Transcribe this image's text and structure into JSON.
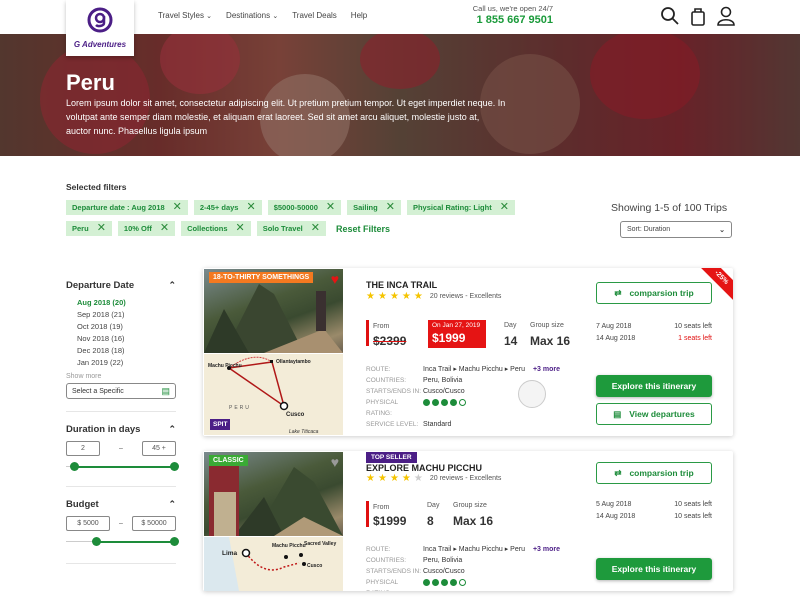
{
  "header": {
    "brand": "G Adventures",
    "nav": [
      {
        "label": "Travel Styles",
        "dropdown": true
      },
      {
        "label": "Destinations",
        "dropdown": true
      },
      {
        "label": "Travel Deals",
        "dropdown": false
      },
      {
        "label": "Help",
        "dropdown": false
      }
    ],
    "call_label": "Call us, we're open 24/7",
    "phone": "1 855 667 9501",
    "icons": [
      "search-icon",
      "bag-icon",
      "user-icon"
    ]
  },
  "hero": {
    "title": "Peru",
    "description": "Lorem ipsum dolor sit amet, consectetur adipiscing elit. Ut pretium pretium tempor. Ut eget imperdiet neque. In volutpat ante semper diam molestie, et aliquam erat laoreet. Sed sit amet arcu aliquet, molestie justo at, auctor nunc. Phasellus ligula ipsum"
  },
  "filters": {
    "title": "Selected filters",
    "row1": [
      "Departure date : Aug 2018",
      "2-45+ days",
      "$5000-50000",
      "Sailing",
      "Physical Rating: Light"
    ],
    "row2": [
      "Peru",
      "10% Off",
      "Collections",
      "Solo Travel"
    ],
    "reset_label": "Reset Filters"
  },
  "results": {
    "showing": "Showing 1-5 of  100 Trips",
    "sort": "Sort: Duration"
  },
  "sidebar": {
    "departure": {
      "title": "Departure Date",
      "dates": [
        "Aug 2018 (20)",
        "Sep 2018 (21)",
        "Oct 2018 (19)",
        "Nov 2018 (16)",
        "Dec 2018 (18)",
        "Jan 2019 (22)"
      ],
      "active_index": 0,
      "show_more": "Show more",
      "specific_placeholder": "Select a Specific"
    },
    "duration": {
      "title": "Duration in days",
      "min": "2",
      "max": "45 +",
      "separator": "–",
      "range_min_pct": 0,
      "range_max_pct": 100
    },
    "budget": {
      "title": "Budget",
      "min": "$ 5000",
      "max": "$ 50000",
      "separator": "–",
      "range_min_pct": 25,
      "range_max_pct": 100
    }
  },
  "trips": [
    {
      "tag": "18-TO-THIRTY SOMETHINGS",
      "tag_color": "#f47920",
      "favorited": true,
      "map_badge": "SPIT",
      "map_labels": [
        "Machu Picchu",
        "Ollantaytambo",
        "PERU",
        "Cusco",
        "Lake Titicaca"
      ],
      "discount": "-25%",
      "title": "THE INCA TRAIL",
      "rating": 5,
      "reviews": "20 reviews - Excellents",
      "from_label": "From",
      "old_price": "$2399",
      "promo_date": "On Jan 27, 2019",
      "price": "$1999",
      "day_label": "Day",
      "days": "14",
      "group_label": "Group size",
      "group": "Max 16",
      "details": [
        {
          "k": "ROUTE:",
          "v": "Inca Trail ▸ Machu Picchu ▸ Peru",
          "more": "+3 more"
        },
        {
          "k": "COUNTRIES:",
          "v": "Peru, Bolivia"
        },
        {
          "k": "STARTS/ENDS IN:",
          "v": "Cusco/Cusco"
        },
        {
          "k": "PHYSICAL RATING:",
          "rating": 4,
          "rating_max": 5
        },
        {
          "k": "SERVICE LEVEL:",
          "v": "Standard"
        }
      ],
      "compare_label": "comparsion trip",
      "departures": [
        {
          "date": "7 Aug 2018",
          "seats": "10 seats left",
          "low": false
        },
        {
          "date": "14 Aug 2018",
          "seats": "1 seats left",
          "low": true
        }
      ],
      "explore_label": "Explore this itinerary",
      "view_label": "View departures"
    },
    {
      "tag": "CLASSIC",
      "tag_color": "#3aaa35",
      "favorited": false,
      "badge": "TOP SELLER",
      "map_labels": [
        "Lima",
        "Machu Picchu",
        "Sacred Valley",
        "Cusco"
      ],
      "title": "EXPLORE MACHU PICCHU",
      "rating": 4,
      "reviews": "20 reviews - Excellents",
      "from_label": "From",
      "price": "$1999",
      "day_label": "Day",
      "days": "8",
      "group_label": "Group size",
      "group": "Max 16",
      "details": [
        {
          "k": "ROUTE:",
          "v": "Inca Trail ▸ Machu Picchu ▸ Peru",
          "more": "+3 more"
        },
        {
          "k": "COUNTRIES:",
          "v": "Peru, Bolivia"
        },
        {
          "k": "STARTS/ENDS IN:",
          "v": "Cusco/Cusco"
        },
        {
          "k": "PHYSICAL RATING:",
          "rating": 4,
          "rating_max": 5
        }
      ],
      "compare_label": "comparsion trip",
      "departures": [
        {
          "date": "5 Aug 2018",
          "seats": "10 seats left",
          "low": false
        },
        {
          "date": "14 Aug 2018",
          "seats": "10 seats left",
          "low": false
        }
      ],
      "explore_label": "Explore this itinerary"
    }
  ],
  "colors": {
    "brand_green": "#1e9a3c",
    "brand_purple": "#4b1e86",
    "sale_red": "#e51414",
    "star": "#f5c400"
  }
}
